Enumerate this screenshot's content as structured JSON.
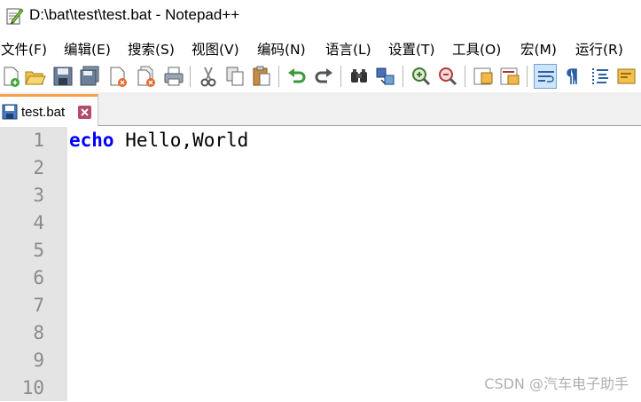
{
  "window": {
    "title": "D:\\bat\\test\\test.bat - Notepad++"
  },
  "menu": [
    "文件(F)",
    "编辑(E)",
    "搜索(S)",
    "视图(V)",
    "编码(N)",
    "语言(L)",
    "设置(T)",
    "工具(O)",
    "宏(M)",
    "运行(R)"
  ],
  "toolbar": {
    "buttons": [
      "new-file",
      "open-file",
      "save",
      "save-all",
      "close",
      "close-all",
      "print",
      "cut",
      "copy",
      "paste",
      "undo",
      "redo",
      "find",
      "replace",
      "zoom-in",
      "zoom-out",
      "sync-vertical",
      "sync-horizontal",
      "word-wrap",
      "show-all-chars",
      "indent-guide",
      "user-defined-language"
    ]
  },
  "tabs": [
    {
      "label": "test.bat"
    }
  ],
  "editor": {
    "line_numbers": [
      "1",
      "2",
      "3",
      "4",
      "5",
      "6",
      "7",
      "8",
      "9",
      "10"
    ],
    "lines": [
      {
        "keyword": "echo",
        "text": " Hello,World"
      }
    ]
  },
  "watermark": "CSDN @汽车电子助手"
}
